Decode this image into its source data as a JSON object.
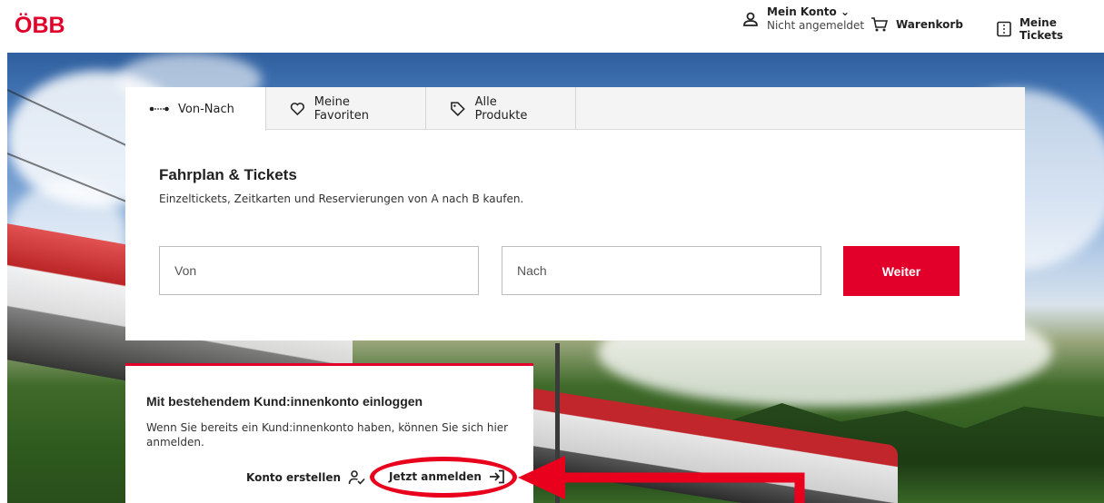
{
  "header": {
    "logo": "ÖBB",
    "account_label": "Mein Konto",
    "account_status": "Nicht angemeldet",
    "cart_label": "Warenkorb",
    "tickets_label": "Meine Tickets"
  },
  "tabs": [
    {
      "label": "Von-Nach",
      "icon": "route-dots-icon",
      "active": true
    },
    {
      "label": "Meine Favoriten",
      "icon": "heart-icon",
      "active": false
    },
    {
      "label": "Alle Produkte",
      "icon": "tag-icon",
      "active": false
    }
  ],
  "search": {
    "title": "Fahrplan & Tickets",
    "subtitle": "Einzeltickets, Zeitkarten und Reservierungen von A nach B kaufen.",
    "from_placeholder": "Von",
    "to_placeholder": "Nach",
    "submit_label": "Weiter"
  },
  "login": {
    "title": "Mit bestehendem Kund:innenkonto einloggen",
    "text": "Wenn Sie bereits ein Kund:innenkonto haben, können Sie sich hier anmelden.",
    "create_label": "Konto erstellen",
    "login_label": "Jetzt anmelden"
  },
  "colors": {
    "brand_red": "#e2002a",
    "annotation_red": "#e8001c"
  }
}
